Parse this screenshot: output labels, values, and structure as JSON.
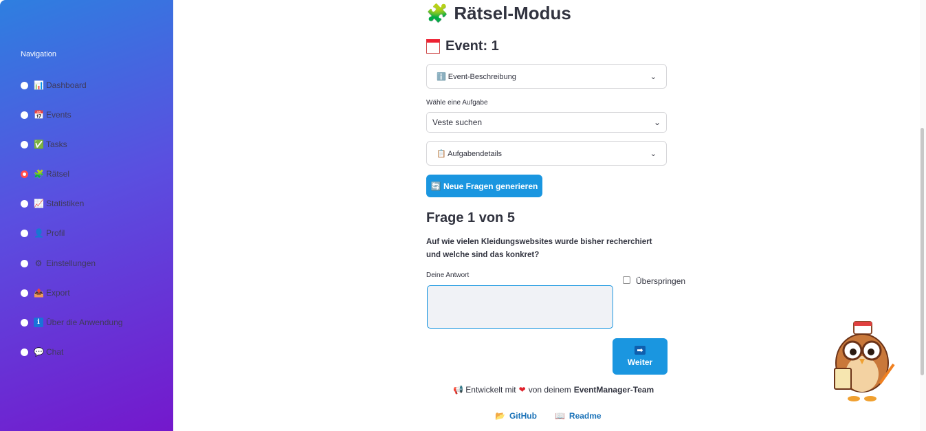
{
  "sidebar": {
    "title": "Navigation",
    "items": [
      {
        "label": "Dashboard",
        "icon": "📊"
      },
      {
        "label": "Events",
        "icon": "📅"
      },
      {
        "label": "Tasks",
        "icon": "✅"
      },
      {
        "label": "Rätsel",
        "icon": "🧩",
        "selected": true
      },
      {
        "label": "Statistiken",
        "icon": "📈"
      },
      {
        "label": "Profil",
        "icon": "👤"
      },
      {
        "label": "Einstellungen",
        "icon": "⚙"
      },
      {
        "label": "Export",
        "icon": "📤"
      },
      {
        "label": "Über die Anwendung",
        "icon": "ℹ"
      },
      {
        "label": "Chat",
        "icon": "💬"
      }
    ]
  },
  "main": {
    "title": "Rätsel-Modus",
    "event_heading": "Event: 1",
    "event_description_label": "ℹ️ Event-Beschreibung",
    "task_select_label": "Wähle eine Aufgabe",
    "task_select_value": "Veste suchen",
    "task_details_label": "📋 Aufgabendetails",
    "generate_button": "🔄 Neue Fragen generieren",
    "question_heading": "Frage 1 von 5",
    "question_text": "Auf wie vielen Kleidungswebsites wurde bisher recherchiert und welche sind das konkret?",
    "answer_label": "Deine Antwort",
    "answer_value": "",
    "skip_label": "Überspringen",
    "next_button_icon": "➡",
    "next_button_label": "Weiter"
  },
  "footer": {
    "text_prefix": "📢 Entwickelt mit",
    "heart": "❤",
    "text_middle": "von deinem",
    "team": "EventManager-Team",
    "github": "GitHub",
    "readme": "Readme"
  },
  "colors": {
    "accent": "#1a96e0",
    "selected_radio": "#ff4b4b"
  }
}
